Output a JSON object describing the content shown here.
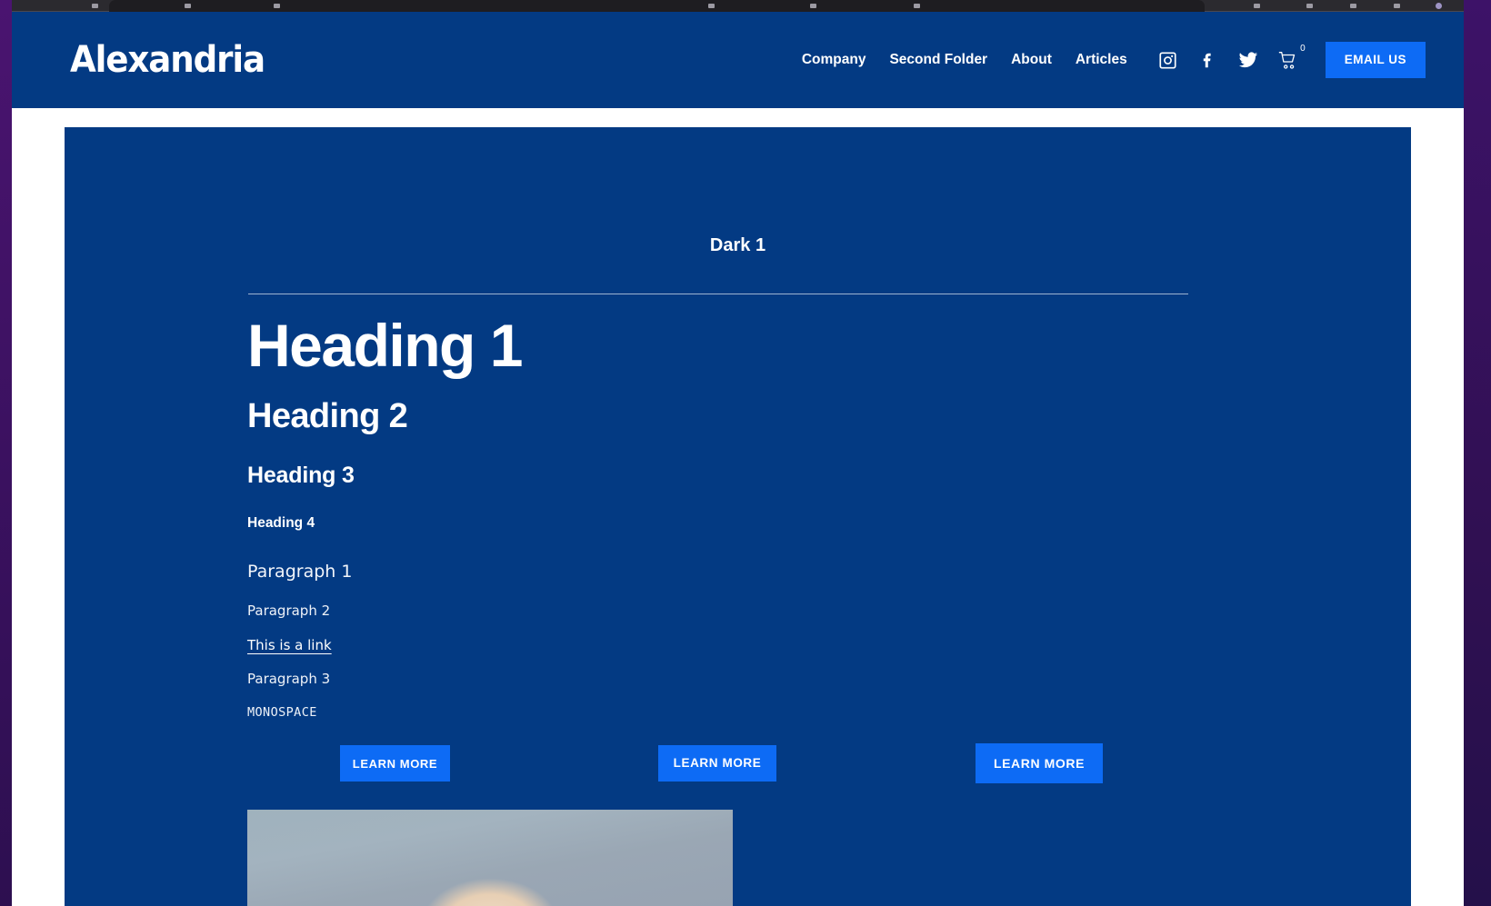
{
  "browser": {
    "chrome_visible": true
  },
  "header": {
    "brand": "Alexandria",
    "nav_links": [
      {
        "label": "Company"
      },
      {
        "label": "Second Folder"
      },
      {
        "label": "About"
      },
      {
        "label": "Articles"
      }
    ],
    "icons": [
      {
        "name": "instagram-icon"
      },
      {
        "name": "facebook-icon"
      },
      {
        "name": "twitter-icon"
      },
      {
        "name": "cart-icon"
      }
    ],
    "cart_count": "0",
    "email_button": "EMAIL US",
    "background_color": "#033a83",
    "accent_color": "#0d6bf5"
  },
  "content": {
    "section_label": "Dark 1",
    "heading1": "Heading 1",
    "heading2": "Heading 2",
    "heading3": "Heading 3",
    "heading4": "Heading 4",
    "paragraph1": "Paragraph 1",
    "paragraph2": "Paragraph 2",
    "link_text": "This is a link",
    "paragraph3": "Paragraph 3",
    "monospace": "MONOSPACE",
    "buttons": [
      {
        "label": "LEARN MORE"
      },
      {
        "label": "LEARN MORE"
      },
      {
        "label": "LEARN MORE"
      }
    ],
    "card_background": "#033a83"
  }
}
